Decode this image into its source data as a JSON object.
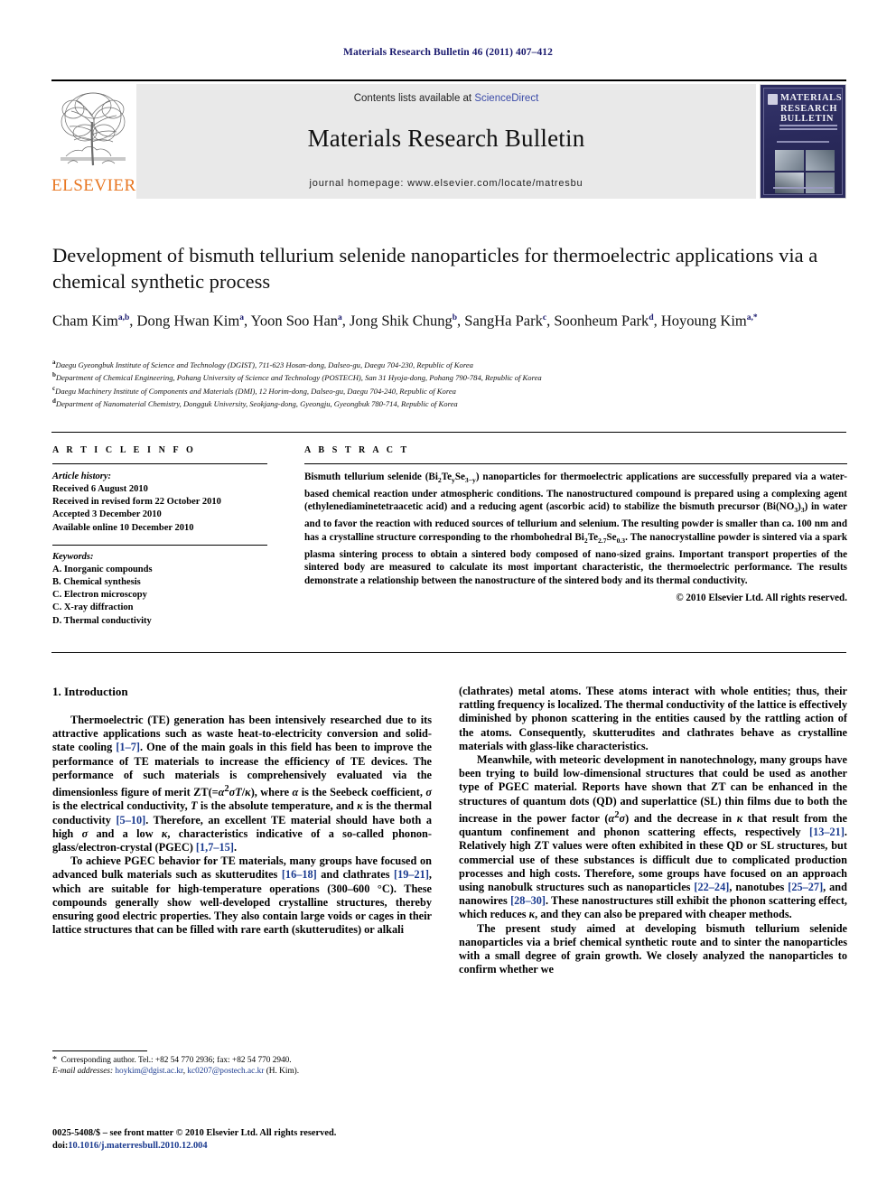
{
  "running_head": "Materials Research Bulletin 46 (2011) 407–412",
  "masthead": {
    "elsevier_wordmark": "ELSEVIER",
    "contents_prefix": "Contents lists available at ",
    "contents_link": "ScienceDirect",
    "journal_name": "Materials Research Bulletin",
    "homepage": "journal homepage: www.elsevier.com/locate/matresbu",
    "cover": {
      "line1": "MATERIALS",
      "line2": "RESEARCH",
      "line3": "BULLETIN"
    }
  },
  "article": {
    "title": "Development of bismuth tellurium selenide nanoparticles for thermoelectric applications via a chemical synthetic process",
    "authors_html": "Cham Kim<sup>a,b</sup>, Dong Hwan Kim<sup>a</sup>, Yoon Soo Han<sup>a</sup>, Jong Shik Chung<sup>b</sup>, SangHa Park<sup>c</sup>, Soonheum Park<sup>d</sup>, Hoyoung Kim<sup>a,*</sup>",
    "affiliations": [
      {
        "marker": "a",
        "text": "Daegu Gyeongbuk Institute of Science and Technology (DGIST), 711-623 Hosan-dong, Dalseo-gu, Daegu 704-230, Republic of Korea"
      },
      {
        "marker": "b",
        "text": "Department of Chemical Engineering, Pohang University of Science and Technology (POSTECH), San 31 Hyoja-dong, Pohang 790-784, Republic of Korea"
      },
      {
        "marker": "c",
        "text": "Daegu Machinery Institute of Components and Materials (DMI), 12 Horim-dong, Dalseo-gu, Daegu 704-240, Republic of Korea"
      },
      {
        "marker": "d",
        "text": "Department of Nanomaterial Chemistry, Dongguk University, Seokjang-dong, Gyeongju, Gyeongbuk 780-714, Republic of Korea"
      }
    ]
  },
  "article_info": {
    "heading": "A R T I C L E   I N F O",
    "history_label": "Article history:",
    "history": [
      "Received 6 August 2010",
      "Received in revised form 22 October 2010",
      "Accepted 3 December 2010",
      "Available online 10 December 2010"
    ],
    "keywords_label": "Keywords:",
    "keywords": [
      "A. Inorganic compounds",
      "B. Chemical synthesis",
      "C. Electron microscopy",
      "C. X-ray diffraction",
      "D. Thermal conductivity"
    ]
  },
  "abstract": {
    "heading": "A B S T R A C T",
    "body_html": "Bismuth tellurium selenide (Bi<sub>2</sub>Te<sub>y</sub>Se<sub>3&minus;y</sub>) nanoparticles for thermoelectric applications are successfully prepared via a water-based chemical reaction under atmospheric conditions. The nanostructured compound is prepared using a complexing agent (ethylenediaminetetraacetic acid) and a reducing agent (ascorbic acid) to stabilize the bismuth precursor (Bi(NO<sub>3</sub>)<sub>3</sub>) in water and to favor the reaction with reduced sources of tellurium and selenium. The resulting powder is smaller than ca. 100 nm and has a crystalline structure corresponding to the rhombohedral Bi<sub>2</sub>Te<sub>2.7</sub>Se<sub>0.3</sub>. The nanocrystalline powder is sintered via a spark plasma sintering process to obtain a sintered body composed of nano-sized grains. Important transport properties of the sintered body are measured to calculate its most important characteristic, the thermoelectric performance. The results demonstrate a relationship between the nanostructure of the sintered body and its thermal conductivity.",
    "copyright": "© 2010 Elsevier Ltd. All rights reserved."
  },
  "body": {
    "section_heading": "1. Introduction",
    "left_paragraphs_html": [
      "Thermoelectric (TE) generation has been intensively researched due to its attractive applications such as waste heat-to-electricity conversion and solid-state cooling <span class=\"ref\">[1&ndash;7]</span>. One of the main goals in this field has been to improve the performance of TE materials to increase the efficiency of TE devices. The performance of such materials is comprehensively evaluated via the dimensionless figure of merit ZT(=<span class=\"it\">&alpha;</span><sup>2</sup><span class=\"it\">&sigma;T</span>/<span class=\"it\">&kappa;</span>), where <span class=\"it\">&alpha;</span> is the Seebeck coefficient, <span class=\"it\">&sigma;</span> is the electrical conductivity, <span class=\"it\">T</span> is the absolute temperature, and <span class=\"it\">&kappa;</span> is the thermal conductivity <span class=\"ref\">[5&ndash;10]</span>. Therefore, an excellent TE material should have both a high <span class=\"it\">&sigma;</span> and a low <span class=\"it\">&kappa;</span>, characteristics indicative of a so-called phonon-glass/electron-crystal (PGEC) <span class=\"ref\">[1,7&ndash;15]</span>.",
      "To achieve PGEC behavior for TE materials, many groups have focused on advanced bulk materials such as skutterudites <span class=\"ref\">[16&ndash;18]</span> and clathrates <span class=\"ref\">[19&ndash;21]</span>, which are suitable for high-temperature operations (300&ndash;600 &deg;C). These compounds generally show well-developed crystalline structures, thereby ensuring good electric properties. They also contain large voids or cages in their lattice structures that can be filled with rare earth (skutterudites) or alkali"
    ],
    "right_paragraphs_html": [
      "(clathrates) metal atoms. These atoms interact with whole entities; thus, their rattling frequency is localized. The thermal conductivity of the lattice is effectively diminished by phonon scattering in the entities caused by the rattling action of the atoms. Consequently, skutterudites and clathrates behave as crystalline materials with glass-like characteristics.",
      "Meanwhile, with meteoric development in nanotechnology, many groups have been trying to build low-dimensional structures that could be used as another type of PGEC material. Reports have shown that ZT can be enhanced in the structures of quantum dots (QD) and superlattice (SL) thin films due to both the increase in the power factor (<span class=\"it\">&alpha;</span><sup>2</sup><span class=\"it\">&sigma;</span>) and the decrease in <span class=\"it\">&kappa;</span> that result from the quantum confinement and phonon scattering effects, respectively <span class=\"ref\">[13&ndash;21]</span>. Relatively high ZT values were often exhibited in these QD or SL structures, but commercial use of these substances is difficult due to complicated production processes and high costs. Therefore, some groups have focused on an approach using nanobulk structures such as nanoparticles <span class=\"ref\">[22&ndash;24]</span>, nanotubes <span class=\"ref\">[25&ndash;27]</span>, and nanowires <span class=\"ref\">[28&ndash;30]</span>. These nanostructures still exhibit the phonon scattering effect, which reduces <span class=\"it\">&kappa;</span>, and they can also be prepared with cheaper methods.",
      "The present study aimed at developing bismuth tellurium selenide nanoparticles via a brief chemical synthetic route and to sinter the nanoparticles with a small degree of grain growth. We closely analyzed the nanoparticles to confirm whether we"
    ]
  },
  "footnotes": {
    "corresponding_html": "<span class=\"star\">*</span>&nbsp; Corresponding author. Tel.: +82 54 770 2936; fax: +82 54 770 2940.",
    "email_label": "E-mail addresses:",
    "email_1": "hoykim@dgist.ac.kr",
    "email_2": "kc0207@postech.ac.kr",
    "email_suffix": "(H. Kim)."
  },
  "imprint": {
    "line1": "0025-5408/$ – see front matter © 2010 Elsevier Ltd. All rights reserved.",
    "doi_label": "doi:",
    "doi_value": "10.1016/j.materresbull.2010.12.004"
  },
  "colors": {
    "link": "#1a3a8f",
    "running_head": "#1a1a6e",
    "elsevier_orange": "#E87722",
    "band_gray": "#e9e9e9",
    "cover_navy": "#2b2b5e"
  }
}
